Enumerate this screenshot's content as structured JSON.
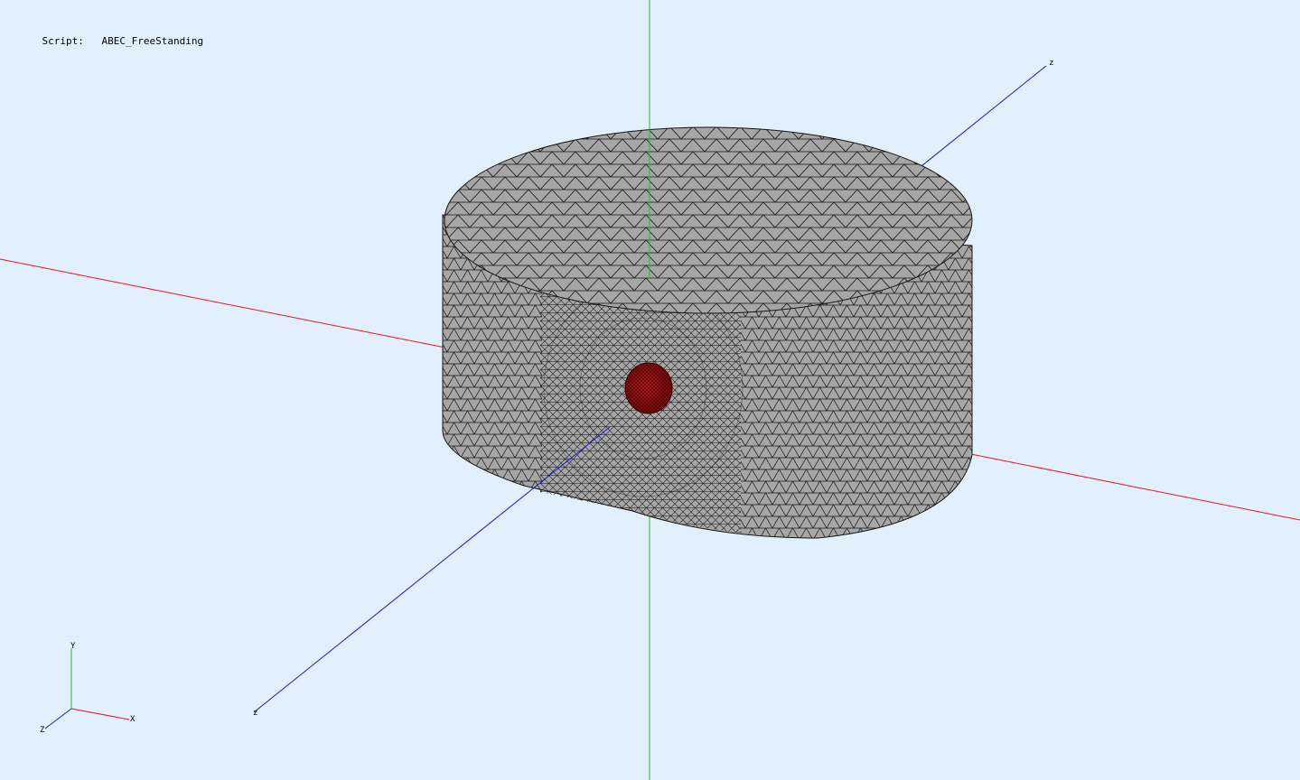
{
  "header": {
    "script_label": "Script:",
    "script_name": "ABEC_FreeStanding"
  },
  "scene_axes": {
    "z_far_label": "z",
    "z_near_label": "z",
    "x_color": "#e8161a",
    "y_color": "#16c816",
    "z_color": "#1a1ad4"
  },
  "mesh": {
    "type": "cylinder-fem-mesh",
    "face_color": "#a6a6a6",
    "edge_color": "#151515",
    "source_color": "#8b0f0f"
  },
  "orientation_triad": {
    "x_label": "X",
    "y_label": "Y",
    "z_label": "Z"
  }
}
